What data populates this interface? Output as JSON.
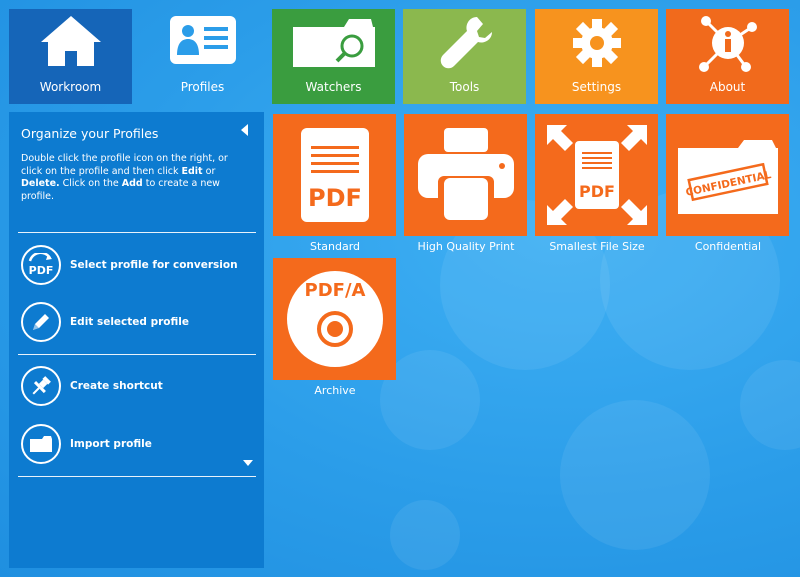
{
  "nav": [
    {
      "label": "Workroom",
      "icon": "home-icon",
      "color": "#1565b8",
      "active": true
    },
    {
      "label": "Profiles",
      "icon": "profiles-icon",
      "color": "transparent",
      "active": false
    },
    {
      "label": "Watchers",
      "icon": "watchers-icon",
      "color": "#3a9d3f"
    },
    {
      "label": "Tools",
      "icon": "tools-icon",
      "color": "#8bb84e"
    },
    {
      "label": "Settings",
      "icon": "settings-icon",
      "color": "#f7931e"
    },
    {
      "label": "About",
      "icon": "about-icon",
      "color": "#f16a1c"
    }
  ],
  "sidebar": {
    "title": "Organize your Profiles",
    "desc_1": "Double click the profile icon on the right, or click on the profile and then click ",
    "desc_edit": "Edit",
    "desc_2": " or ",
    "desc_delete": "Delete.",
    "desc_3": " Click on the ",
    "desc_add": "Add",
    "desc_4": " to create a new profile.",
    "actions": [
      {
        "label": "Select profile for conversion",
        "icon": "pdf-icon"
      },
      {
        "label": "Edit selected profile",
        "icon": "pencil-icon"
      },
      {
        "label": "Create shortcut",
        "icon": "pin-icon"
      },
      {
        "label": "Import profile",
        "icon": "folder-icon"
      }
    ]
  },
  "profiles": [
    {
      "label": "Standard",
      "icon_text": "PDF"
    },
    {
      "label": "High Quality Print",
      "icon_text": ""
    },
    {
      "label": "Smallest File Size",
      "icon_text": "PDF"
    },
    {
      "label": "Confidential",
      "icon_text": "CONFIDENTIAL"
    },
    {
      "label": "Archive",
      "icon_text": "PDF/A"
    }
  ],
  "colors": {
    "profile_tile": "#f46a1c",
    "sidebar": "#0d7bd0",
    "background": "#2b9de9"
  }
}
